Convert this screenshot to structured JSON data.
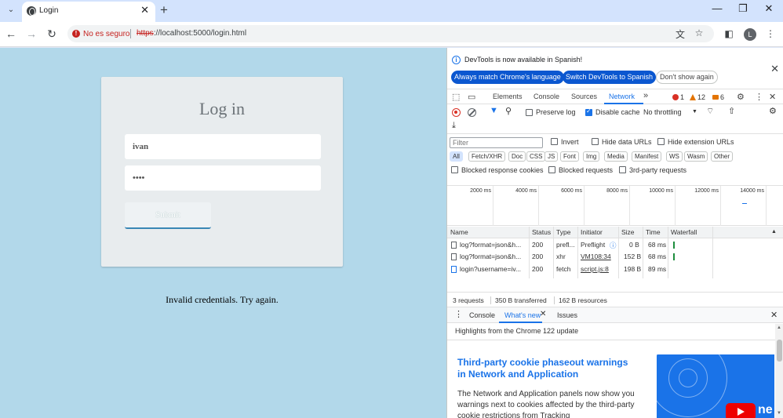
{
  "browser": {
    "tab_title": "Login",
    "security_text": "No es seguro",
    "url_scheme": "https",
    "url_rest": "://localhost:5000/login.html",
    "profile_initial": "L"
  },
  "page": {
    "title": "Log in",
    "username_value": "ivan",
    "password_value": "••••",
    "submit_label": "Submit",
    "message": "Invalid credentials. Try again."
  },
  "devtools": {
    "notice": "DevTools is now available in Spanish!",
    "btn_always_match": "Always match Chrome's language",
    "btn_switch": "Switch DevTools to Spanish",
    "btn_dont_show": "Don't show again",
    "tabs": [
      "Elements",
      "Console",
      "Sources",
      "Network"
    ],
    "more_tabs": "»",
    "errors": "1",
    "warnings": "12",
    "issues": "6",
    "preserve_log": "Preserve log",
    "disable_cache": "Disable cache",
    "throttling": "No throttling",
    "filter_placeholder": "Filter",
    "invert": "Invert",
    "hide_data_urls": "Hide data URLs",
    "hide_ext_urls": "Hide extension URLs",
    "type_filters": [
      "All",
      "Fetch/XHR",
      "Doc",
      "CSS",
      "JS",
      "Font",
      "Img",
      "Media",
      "Manifest",
      "WS",
      "Wasm",
      "Other"
    ],
    "blocked_cookies": "Blocked response cookies",
    "blocked_requests": "Blocked requests",
    "third_party": "3rd-party requests",
    "timeline_ticks": [
      "2000 ms",
      "4000 ms",
      "6000 ms",
      "8000 ms",
      "10000 ms",
      "12000 ms",
      "14000 ms"
    ],
    "columns": [
      "Name",
      "Status",
      "Type",
      "Initiator",
      "Size",
      "Time",
      "Waterfall"
    ],
    "rows": [
      {
        "name": "log?format=json&h...",
        "status": "200",
        "type": "prefl...",
        "initiator": "Preflight",
        "size": "0 B",
        "time": "68 ms"
      },
      {
        "name": "log?format=json&h...",
        "status": "200",
        "type": "xhr",
        "initiator": "VM108:34",
        "size": "152 B",
        "time": "68 ms"
      },
      {
        "name": "login?username=iv...",
        "status": "200",
        "type": "fetch",
        "initiator": "script.js:8",
        "size": "198 B",
        "time": "89 ms"
      }
    ],
    "summary_requests": "3 requests",
    "summary_transferred": "350 B transferred",
    "summary_resources": "162 B resources",
    "drawer_tabs": [
      "Console",
      "What's new",
      "Issues"
    ],
    "whatsnew_sub": "Highlights from the Chrome 122 update",
    "whatsnew_heading": "Third-party cookie phaseout warnings in Network and Application",
    "whatsnew_body": "The Network and Application panels now show you warnings next to cookies affected by the third-party cookie restrictions from Tracking",
    "thumb_text": "ne"
  }
}
